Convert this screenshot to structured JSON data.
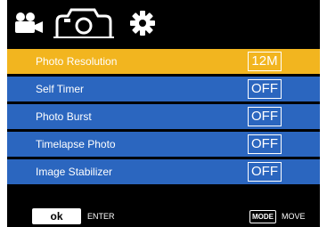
{
  "tabs": [
    {
      "name": "video",
      "icon": "video-camera-icon"
    },
    {
      "name": "photo",
      "icon": "photo-camera-icon",
      "active": true
    },
    {
      "name": "settings",
      "icon": "gear-icon"
    }
  ],
  "menu": {
    "items": [
      {
        "label": "Photo Resolution",
        "value": "12M",
        "selected": true
      },
      {
        "label": "Self Timer",
        "value": "OFF"
      },
      {
        "label": "Photo Burst",
        "value": "OFF"
      },
      {
        "label": "Timelapse Photo",
        "value": "OFF"
      },
      {
        "label": "Image Stabilizer",
        "value": "OFF"
      }
    ]
  },
  "footer": {
    "ok_label": "ok",
    "enter_label": "ENTER",
    "mode_label": "MODE",
    "move_label": "MOVE"
  },
  "colors": {
    "row_background": "#2b66bf",
    "selected_background": "#f2b51f",
    "screen_background": "#000000"
  }
}
